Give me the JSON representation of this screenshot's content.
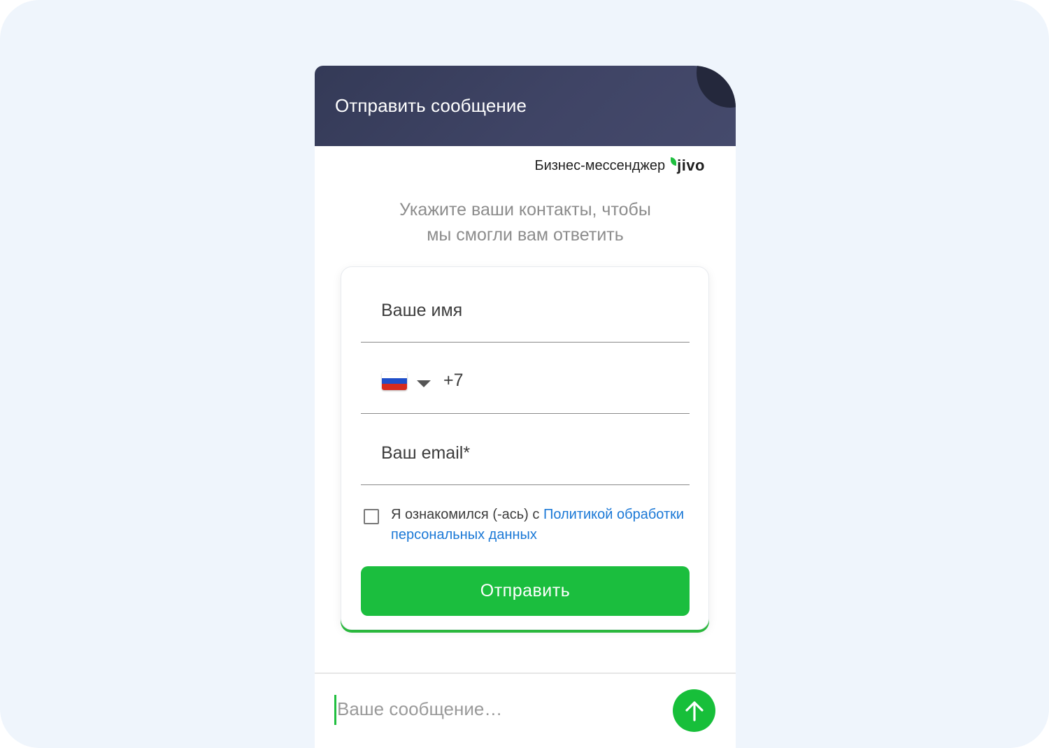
{
  "header": {
    "title": "Отправить сообщение"
  },
  "brand": {
    "label": "Бизнес-мессенджер",
    "logo_text": "jivo"
  },
  "prompt": {
    "line1": "Укажите ваши контакты, чтобы",
    "line2": "мы смогли вам ответить"
  },
  "form": {
    "name_placeholder": "Ваше имя",
    "phone": {
      "country_flag": "russia-flag-icon",
      "code": "+7"
    },
    "email_placeholder": "Ваш email*",
    "consent": {
      "checked": false,
      "text": "Я ознакомился (-ась) с ",
      "link_text": "Политикой обработки персональных данных"
    },
    "submit_label": "Отправить"
  },
  "composer": {
    "placeholder": "Ваше сообщение…",
    "send_icon": "arrow-up-icon"
  },
  "colors": {
    "accent": "#1bbe3e",
    "header_bg": "#3c4161",
    "link": "#1a78d6",
    "page_bg": "#eff5fc"
  }
}
